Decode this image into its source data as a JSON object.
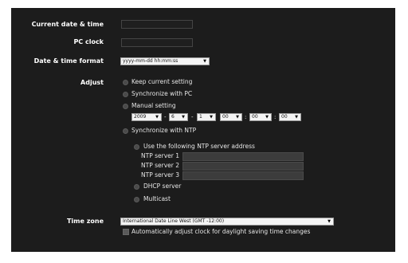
{
  "labels": {
    "current_date_time": "Current date & time",
    "pc_clock": "PC clock",
    "date_time_format": "Date & time format",
    "adjust": "Adjust",
    "time_zone": "Time zone"
  },
  "date_format": {
    "value": "yyyy-mm-dd hh:mm:ss"
  },
  "adjust_options": {
    "keep_current": "Keep current setting",
    "sync_pc": "Synchronize with PC",
    "manual": "Manual setting",
    "sync_ntp": "Synchronize with NTP"
  },
  "manual_setting": {
    "year": "2009",
    "month": "6",
    "day": "1",
    "hour": "00",
    "minute": "00",
    "second": "00",
    "date_sep": "-",
    "time_sep": ":"
  },
  "ntp": {
    "use_following": "Use the following NTP server address",
    "server1_label": "NTP server 1",
    "server2_label": "NTP server 2",
    "server3_label": "NTP server 3",
    "dhcp": "DHCP server",
    "multicast": "Multicast"
  },
  "timezone": {
    "value": "International Date Line West (GMT -12:00)"
  },
  "dst": {
    "label": "Automatically adjust clock for daylight saving time changes"
  },
  "icons": {
    "dropdown_arrow": "▼"
  }
}
